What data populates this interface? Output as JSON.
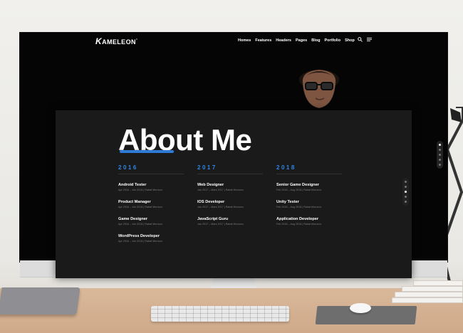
{
  "site": {
    "logo": "AMELEON",
    "logo_initial": "K",
    "logo_mark": "°"
  },
  "nav": {
    "items": [
      "Homes",
      "Features",
      "Headers",
      "Pages",
      "Blog",
      "Portfolio",
      "Shop"
    ],
    "icons": [
      "search-icon",
      "menu-icon"
    ]
  },
  "about": {
    "title": "About Me",
    "accent_color": "#2e7bd6"
  },
  "columns": [
    {
      "year": "2016",
      "entries": [
        {
          "title": "Android Tester",
          "meta": "Apr 2016 – Jun 2016 | Rabat Morocco"
        },
        {
          "title": "Product Manager",
          "meta": "Apr 2016 – Jun 2016 | Rabat Morocco"
        },
        {
          "title": "Game Designer",
          "meta": "Apr 2016 – Jun 2016 | Rabat Morocco"
        },
        {
          "title": "WordPress Developer",
          "meta": "Apr 2016 – Jun 2016 | Rabat Morocco"
        }
      ]
    },
    {
      "year": "2017",
      "entries": [
        {
          "title": "Web Designer",
          "meta": "Jan 2017 – Mars 2017 | Rabat Morocco"
        },
        {
          "title": "IOS Developer",
          "meta": "Jan 2017 – Mars 2017 | Rabat Morocco"
        },
        {
          "title": "JavaScript Guru",
          "meta": "Jan 2017 – Mars 2017 | Rabat Morocco"
        }
      ]
    },
    {
      "year": "2018",
      "entries": [
        {
          "title": "Senior Game Designer",
          "meta": "Feb 2018 – Aug 2018 | Rabat Morocco"
        },
        {
          "title": "Unity Tester",
          "meta": "Feb 2018 – Aug 2018 | Rabat Morocco"
        },
        {
          "title": "Application Developer",
          "meta": "Feb 2018 – Aug 2018 | Rabat Morocco"
        }
      ]
    }
  ]
}
